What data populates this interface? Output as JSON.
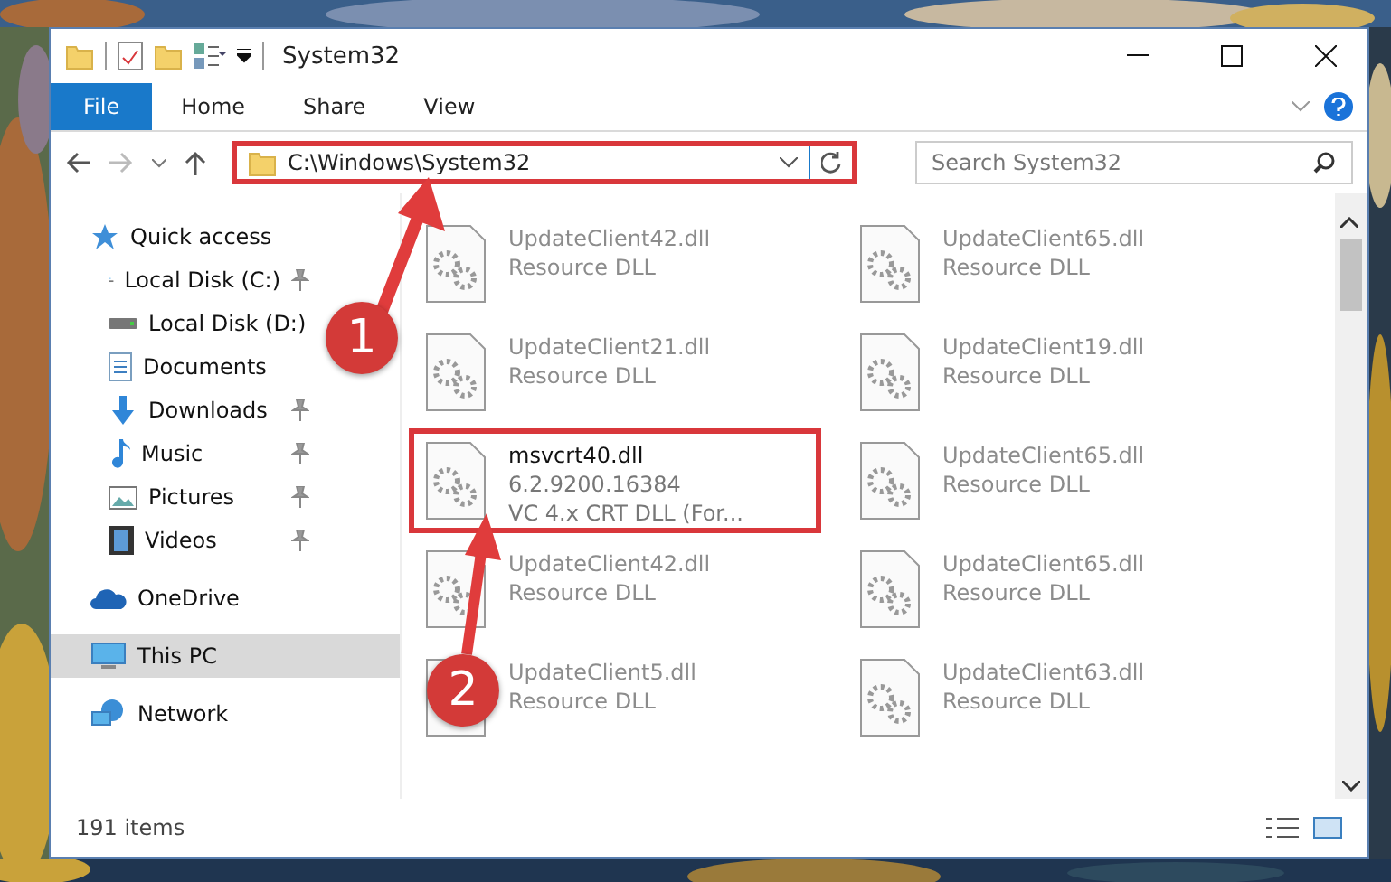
{
  "window": {
    "title": "System32"
  },
  "ribbon_tabs": [
    {
      "label": "File",
      "selected": true
    },
    {
      "label": "Home",
      "selected": false
    },
    {
      "label": "Share",
      "selected": false
    },
    {
      "label": "View",
      "selected": false
    }
  ],
  "address": {
    "path": "C:\\Windows\\System32",
    "highlighted": true
  },
  "search": {
    "placeholder": "Search System32"
  },
  "sidebar": {
    "items": [
      {
        "label": "Quick access",
        "selected": false,
        "children": [
          {
            "label": "Local Disk (C:)",
            "pinned": true,
            "selected": false
          },
          {
            "label": "Local Disk (D:)",
            "pinned": false,
            "selected": false
          },
          {
            "label": "Documents",
            "pinned": false,
            "selected": false
          },
          {
            "label": "Downloads",
            "pinned": true,
            "selected": false
          },
          {
            "label": "Music",
            "pinned": true,
            "selected": false
          },
          {
            "label": "Pictures",
            "pinned": true,
            "selected": false
          },
          {
            "label": "Videos",
            "pinned": true,
            "selected": false
          }
        ]
      },
      {
        "label": "OneDrive",
        "selected": false
      },
      {
        "label": "This PC",
        "selected": true
      },
      {
        "label": "Network",
        "selected": false
      }
    ]
  },
  "files": [
    {
      "name": "UpdateClient42.dll",
      "lines": [
        "Resource DLL"
      ],
      "blurred": true,
      "highlighted": false
    },
    {
      "name": "UpdateClient65.dll",
      "lines": [
        "Resource DLL"
      ],
      "blurred": true,
      "highlighted": false
    },
    {
      "name": "UpdateClient21.dll",
      "lines": [
        "Resource DLL"
      ],
      "blurred": true,
      "highlighted": false
    },
    {
      "name": "UpdateClient19.dll",
      "lines": [
        "Resource DLL"
      ],
      "blurred": true,
      "highlighted": false
    },
    {
      "name": "msvcrt40.dll",
      "lines": [
        "6.2.9200.16384",
        "VC 4.x CRT DLL (For..."
      ],
      "blurred": false,
      "highlighted": true
    },
    {
      "name": "UpdateClient65.dll",
      "lines": [
        "Resource DLL"
      ],
      "blurred": true,
      "highlighted": false
    },
    {
      "name": "UpdateClient42.dll",
      "lines": [
        "Resource DLL"
      ],
      "blurred": true,
      "highlighted": false
    },
    {
      "name": "UpdateClient65.dll",
      "lines": [
        "Resource DLL"
      ],
      "blurred": true,
      "highlighted": false
    },
    {
      "name": "UpdateClient5.dll",
      "lines": [
        "Resource DLL"
      ],
      "blurred": true,
      "highlighted": false
    },
    {
      "name": "UpdateClient63.dll",
      "lines": [
        "Resource DLL"
      ],
      "blurred": true,
      "highlighted": false
    }
  ],
  "status_bar": {
    "count": "191 items"
  },
  "callouts": [
    "1",
    "2"
  ]
}
